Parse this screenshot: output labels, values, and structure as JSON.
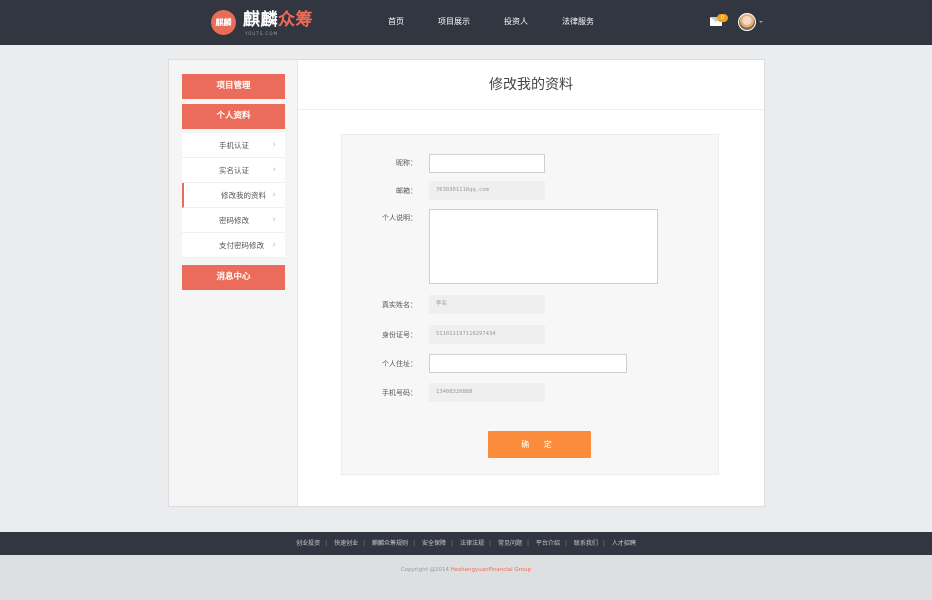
{
  "header": {
    "logo_main": "麒麟",
    "logo_accent": "众筹",
    "logo_sub": "YOUTS.COM",
    "logo_mark": "麒麟",
    "nav": [
      "首页",
      "项目展示",
      "投资人",
      "法律服务"
    ],
    "mail_count": "0"
  },
  "sidebar": {
    "project_mgmt": "项目管理",
    "profile": "个人资料",
    "items": [
      "手机认证",
      "实名认证",
      "修改我的资料",
      "密码修改",
      "支付密码修改"
    ],
    "message_center": "消息中心"
  },
  "main": {
    "title": "修改我的资料",
    "form": {
      "nickname_label": "昵称：",
      "nickname_value": "",
      "email_label": "邮箱：",
      "email_value": "7630301118qq.com",
      "bio_label": "个人说明：",
      "realname_label": "真实姓名：",
      "realname_value": "李名",
      "idcard_label": "身份证号：",
      "idcard_value": "511011197110297434",
      "address_label": "个人住址：",
      "address_value": "",
      "phone_label": "手机号码：",
      "phone_value": "13408320888",
      "submit_label": "确 定"
    }
  },
  "footer": {
    "links": [
      "创业投资",
      "快速创业",
      "麒麟众筹规则",
      "安全保障",
      "法律法规",
      "常见问题",
      "平台介绍",
      "联系我们",
      "人才招聘"
    ],
    "copyright_prefix": "Copyright @2014",
    "copyright_brand": "HeshengyuanFinancial Group"
  },
  "colors": {
    "header_bg": "#323640",
    "accent": "#eb6c5a",
    "submit": "#fb8c3c"
  }
}
